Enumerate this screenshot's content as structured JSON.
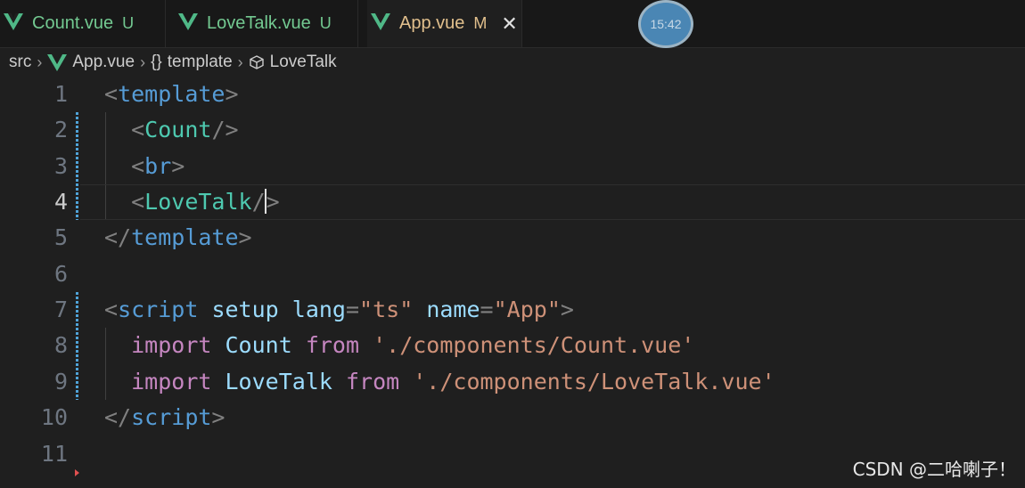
{
  "tabs": [
    {
      "label": "Count.vue",
      "status": "U"
    },
    {
      "label": "LoveTalk.vue",
      "status": "U"
    },
    {
      "label": "App.vue",
      "status": "M"
    }
  ],
  "clock": "15:42",
  "breadcrumb": {
    "folder": "src",
    "file": "App.vue",
    "section": "template",
    "section_icon": "{}",
    "symbol": "LoveTalk"
  },
  "editor": {
    "line_numbers": [
      "1",
      "2",
      "3",
      "4",
      "5",
      "6",
      "7",
      "8",
      "9",
      "10",
      "11"
    ],
    "current_line": "4",
    "code": {
      "template_tag": "template",
      "count_comp": "Count",
      "br_tag": "br",
      "lovetalk_comp": "LoveTalk",
      "script_tag": "script",
      "setup_attr": "setup",
      "lang_attr": "lang",
      "lang_value": "\"ts\"",
      "name_attr": "name",
      "name_value": "\"App\"",
      "import_kw": "import",
      "from_kw": "from",
      "count_ident": "Count",
      "count_path": "'./components/Count.vue'",
      "lovetalk_ident": "LoveTalk",
      "lovetalk_path": "'./components/LoveTalk.vue'"
    }
  },
  "watermark": "CSDN @二哈喇子！",
  "colors": {
    "tag_blue": "#569cd6",
    "component_teal": "#4ec9b0",
    "string_orange": "#ce9178",
    "keyword_purple": "#c586c0",
    "untracked_green": "#73c991",
    "modified_yellow": "#e2c08d"
  }
}
